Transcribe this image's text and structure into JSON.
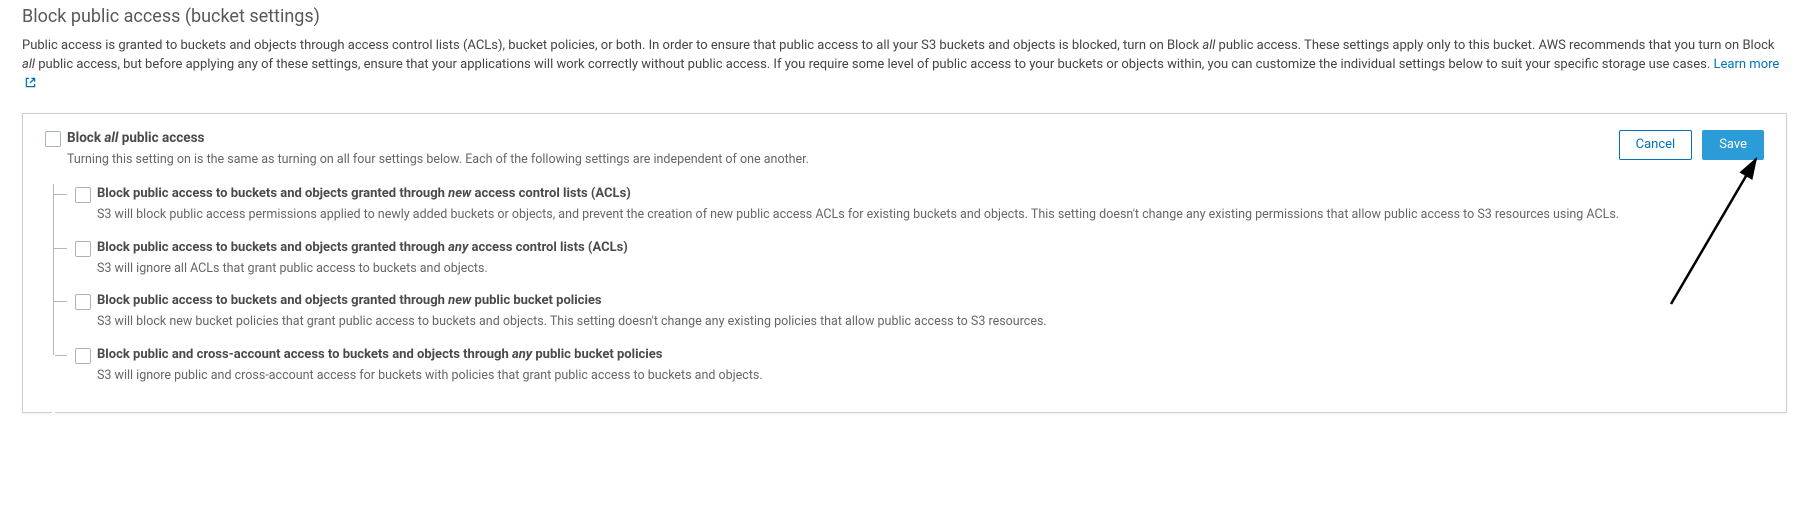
{
  "section": {
    "title": "Block public access (bucket settings)",
    "desc_prefix": "Public access is granted to buckets and objects through access control lists (ACLs), bucket policies, or both. In order to ensure that public access to all your S3 buckets and objects is blocked, turn on Block ",
    "desc_em": "all",
    "desc_suffix": " public access. These settings apply only to this bucket. AWS recommends that you turn on Block ",
    "desc_em2": "all",
    "desc_suffix2": " public access, but before applying any of these settings, ensure that your applications will work correctly without public access. If you require some level of public access to your buckets or objects within, you can customize the individual settings below to suit your specific storage use cases. ",
    "learn_more": "Learn more"
  },
  "actions": {
    "cancel": "Cancel",
    "save": "Save"
  },
  "main_option": {
    "title_prefix": "Block ",
    "title_em": "all",
    "title_suffix": " public access",
    "desc": "Turning this setting on is the same as turning on all four settings below. Each of the following settings are independent of one another."
  },
  "sub_options": [
    {
      "title_prefix": "Block public access to buckets and objects granted through ",
      "title_em": "new",
      "title_suffix": " access control lists (ACLs)",
      "desc": "S3 will block public access permissions applied to newly added buckets or objects, and prevent the creation of new public access ACLs for existing buckets and objects. This setting doesn't change any existing permissions that allow public access to S3 resources using ACLs."
    },
    {
      "title_prefix": "Block public access to buckets and objects granted through ",
      "title_em": "any",
      "title_suffix": " access control lists (ACLs)",
      "desc": "S3 will ignore all ACLs that grant public access to buckets and objects."
    },
    {
      "title_prefix": "Block public access to buckets and objects granted through ",
      "title_em": "new",
      "title_suffix": " public bucket policies",
      "desc": "S3 will block new bucket policies that grant public access to buckets and objects. This setting doesn't change any existing policies that allow public access to S3 resources."
    },
    {
      "title_prefix": "Block public and cross-account access to buckets and objects through ",
      "title_em": "any",
      "title_suffix": " public bucket policies",
      "desc": "S3 will ignore public and cross-account access for buckets with policies that grant public access to buckets and objects."
    }
  ]
}
